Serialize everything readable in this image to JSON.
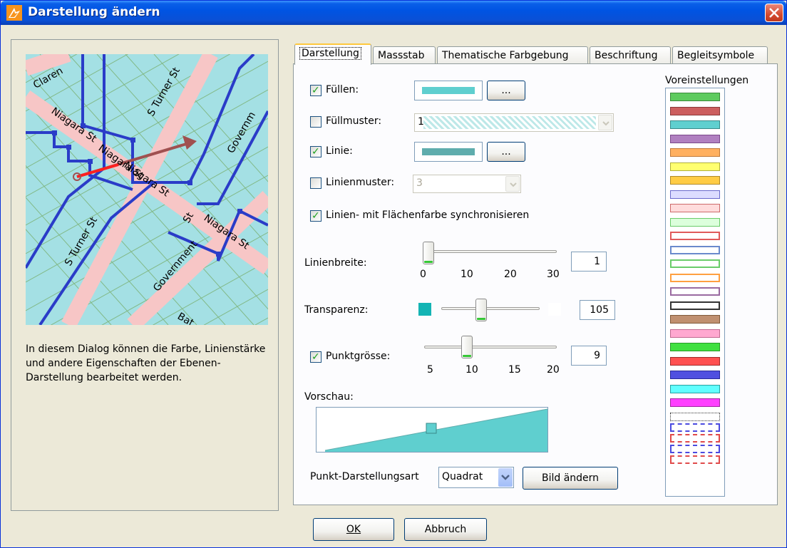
{
  "window": {
    "title": "Darstellung ändern",
    "accent": "#0054e3"
  },
  "map": {
    "labels": [
      "Claren",
      "S Turner St",
      "Niagara St",
      "Niagara St",
      "Governm",
      "Niagara St",
      "S Turner St",
      "Government",
      "Niagara St",
      "St",
      "Bat"
    ]
  },
  "description": "In diesem Dialog können die Farbe, Linienstärke und andere Eigenschaften der Ebenen-Darstellung bearbeitet werden.",
  "tabs": [
    "Darstellung",
    "Massstab",
    "Thematische Farbgebung",
    "Beschriftung",
    "Begleitsymbole"
  ],
  "form": {
    "fill": {
      "label": "Füllen:",
      "checked": true,
      "color": "#5fcfcf",
      "button": "..."
    },
    "fill_pattern": {
      "label": "Füllmuster:",
      "checked": false,
      "value": "1"
    },
    "line": {
      "label": "Linie:",
      "checked": true,
      "color": "#5fadad",
      "button": "..."
    },
    "line_pattern": {
      "label": "Linienmuster:",
      "checked": false,
      "value": "3"
    },
    "sync": {
      "label": "Linien- mit Flächenfarbe synchronisieren",
      "checked": true
    },
    "line_width": {
      "label": "Linienbreite:",
      "value": "1",
      "min": 0,
      "max": 30,
      "ticks": [
        "0",
        "10",
        "20",
        "30"
      ]
    },
    "transparency": {
      "label": "Transparenz:",
      "value": "105",
      "min": 0,
      "max": 255
    },
    "point_size": {
      "label": "Punktgrösse:",
      "checked": true,
      "value": "9",
      "min": 5,
      "max": 20,
      "ticks": [
        "5",
        "10",
        "15",
        "20"
      ]
    },
    "preview_label": "Vorschau:",
    "point_style": {
      "label": "Punkt-Darstellungsart",
      "value": "Quadrat",
      "button": "Bild ändern"
    }
  },
  "presets": {
    "label": "Voreinstellungen",
    "items": [
      {
        "fill": "#5ecb5e",
        "stroke": "#3a8a3a"
      },
      {
        "fill": "#cc5e5e",
        "stroke": "#8a3a3a"
      },
      {
        "fill": "#5fcfcf",
        "stroke": "#3a8a8a"
      },
      {
        "fill": "#b080c0",
        "stroke": "#7a4a8a"
      },
      {
        "fill": "#ffb060",
        "stroke": "#c07a3a"
      },
      {
        "fill": "#ffff70",
        "stroke": "#b0b03a"
      },
      {
        "fill": "#ffcc44",
        "stroke": "#b08a2a"
      },
      {
        "fill": "#dcdcff",
        "stroke": "#6a6acc"
      },
      {
        "fill": "#ffdcdc",
        "stroke": "#cc6a6a"
      },
      {
        "fill": "#dcffdc",
        "stroke": "#6acc6a"
      },
      {
        "fill": "#ffffff",
        "stroke": "#e05a5a"
      },
      {
        "fill": "#ffffff",
        "stroke": "#6a8acc"
      },
      {
        "fill": "#ffffff",
        "stroke": "#6acc6a"
      },
      {
        "fill": "#ffffff",
        "stroke": "#ffa040"
      },
      {
        "fill": "#ffffff",
        "stroke": "#9a6aa0"
      },
      {
        "fill": "#ffffff",
        "stroke": "#333333"
      },
      {
        "fill": "#c09070",
        "stroke": "#805a3a"
      },
      {
        "fill": "#ffa8d0",
        "stroke": "#c06a90"
      },
      {
        "fill": "#40e040",
        "stroke": "#2a9a2a"
      },
      {
        "fill": "#ff5050",
        "stroke": "#a02a2a"
      },
      {
        "fill": "#5050e0",
        "stroke": "#2a2a9a"
      },
      {
        "fill": "#60ffff",
        "stroke": "#2aa0a0"
      },
      {
        "fill": "#ff40ff",
        "stroke": "#a02aa0"
      }
    ],
    "dashed": [
      {
        "stroke": "#333333"
      },
      {
        "stroke": "#4a4ae0"
      },
      {
        "stroke": "#e04a4a"
      },
      {
        "stroke": "#4a4ae0"
      },
      {
        "stroke": "#e04a4a"
      }
    ]
  },
  "footer": {
    "ok": "OK",
    "cancel": "Abbruch"
  }
}
